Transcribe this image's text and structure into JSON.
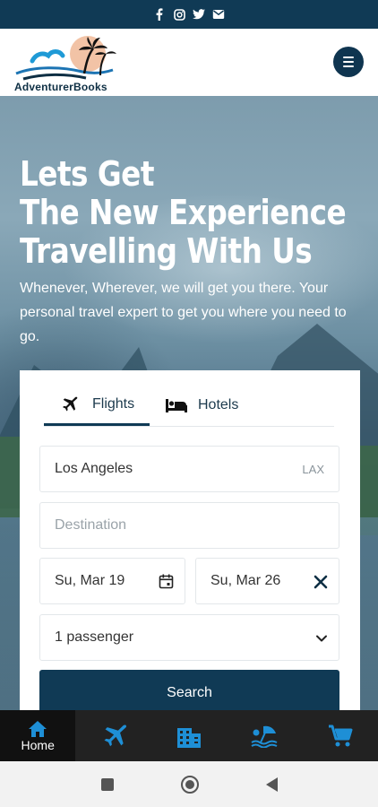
{
  "social": {
    "icons": [
      "facebook-icon",
      "instagram-icon",
      "twitter-icon",
      "email-icon"
    ]
  },
  "header": {
    "brand": "AdventurerBooks",
    "menu_icon": "hamburger-menu-icon"
  },
  "hero": {
    "title_lines": [
      "Lets Get",
      "The New Experience",
      "Travelling With Us"
    ],
    "subtitle": "Whenever, Wherever, we will get you there. Your personal travel expert to get you where you need to go."
  },
  "search_card": {
    "tabs": [
      {
        "label": "Flights",
        "icon": "airplane-icon",
        "active": true
      },
      {
        "label": "Hotels",
        "icon": "bed-icon",
        "active": false
      }
    ],
    "origin": {
      "value": "Los Angeles",
      "code": "LAX"
    },
    "destination": {
      "placeholder": "Destination"
    },
    "depart_date": "Su, Mar 19",
    "return_date": "Su, Mar 26",
    "passengers": "1 passenger",
    "search_label": "Search"
  },
  "bottom_nav": {
    "items": [
      {
        "label": "Home",
        "icon": "home-icon",
        "active": true
      },
      {
        "label": "",
        "icon": "airplane-icon"
      },
      {
        "label": "",
        "icon": "hotel-building-icon"
      },
      {
        "label": "",
        "icon": "beach-icon"
      },
      {
        "label": "",
        "icon": "cart-icon"
      }
    ]
  },
  "colors": {
    "primary": "#103a55",
    "nav_bg": "#222222",
    "accent_blue": "#1e8fd6"
  }
}
